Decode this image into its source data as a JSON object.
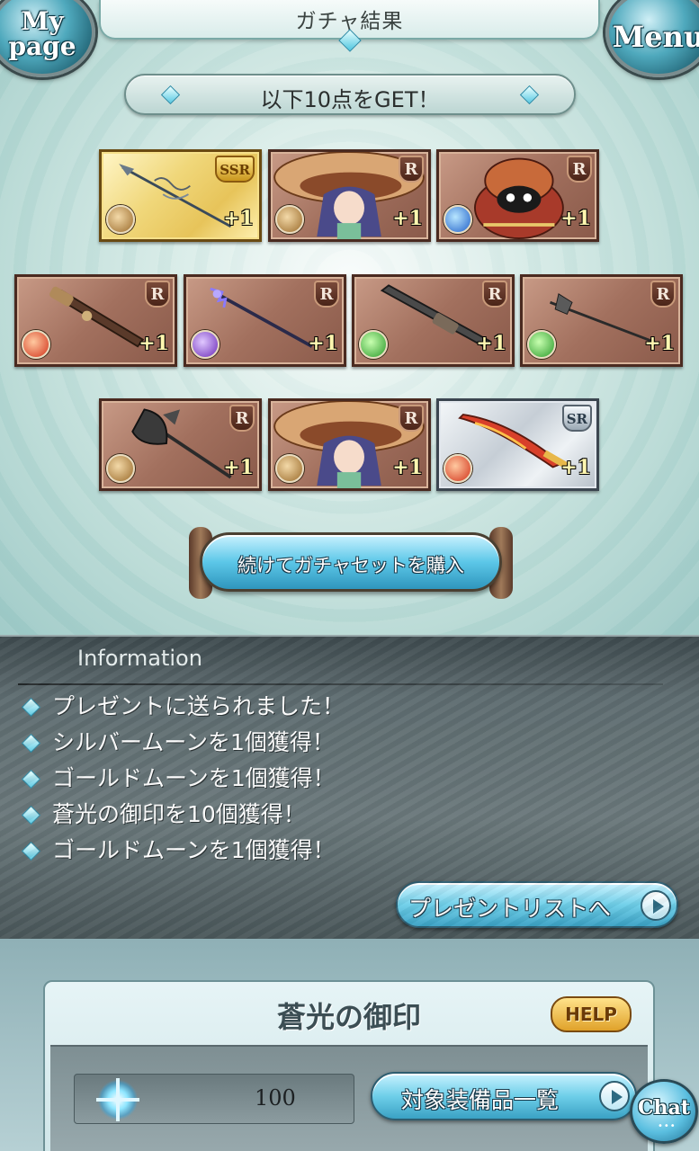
{
  "header": {
    "title": "ガチャ結果",
    "mypage_line1": "My",
    "mypage_line2": "page",
    "menu_label": "Menu"
  },
  "results": {
    "banner": "以下10点をGET！",
    "items": [
      {
        "type": "weapon",
        "subject": "spear",
        "rarity": "SSR",
        "element": "earth",
        "count": "+1"
      },
      {
        "type": "character",
        "subject": "girl-with-hat",
        "rarity": "R",
        "element": "earth",
        "count": "+1"
      },
      {
        "type": "summon",
        "subject": "round-creature",
        "rarity": "R",
        "element": "water",
        "count": "+1"
      },
      {
        "type": "weapon",
        "subject": "gun",
        "rarity": "R",
        "element": "fire",
        "count": "+1"
      },
      {
        "type": "weapon",
        "subject": "staff",
        "rarity": "R",
        "element": "dark",
        "count": "+1"
      },
      {
        "type": "weapon",
        "subject": "rifle",
        "rarity": "R",
        "element": "wind",
        "count": "+1"
      },
      {
        "type": "weapon",
        "subject": "halberd",
        "rarity": "R",
        "element": "wind",
        "count": "+1"
      },
      {
        "type": "weapon",
        "subject": "axe",
        "rarity": "R",
        "element": "earth",
        "count": "+1"
      },
      {
        "type": "character",
        "subject": "girl-with-hat",
        "rarity": "R",
        "element": "earth",
        "count": "+1"
      },
      {
        "type": "weapon",
        "subject": "flame-sword",
        "rarity": "SR",
        "element": "fire",
        "count": "+1"
      }
    ],
    "continue_label": "続けてガチャセットを購入"
  },
  "information": {
    "heading": "Information",
    "messages": [
      "プレゼントに送られました！",
      "シルバームーンを1個獲得！",
      "ゴールドムーンを1個獲得！",
      "蒼光の御印を10個獲得！",
      "ゴールドムーンを1個獲得！"
    ],
    "present_list_label": "プレゼントリストへ"
  },
  "seal": {
    "title": "蒼光の御印",
    "help_label": "HELP",
    "quantity": "100",
    "equipment_list_label": "対象装備品一覧"
  },
  "chat": {
    "label": "Chat"
  },
  "colors": {
    "accent_cyan": "#5cc7e8",
    "panel_dark": "#5e6c70",
    "rarity_ssr": "#e7c45a",
    "rarity_sr": "#c6ced6",
    "rarity_r": "#a2705e"
  }
}
